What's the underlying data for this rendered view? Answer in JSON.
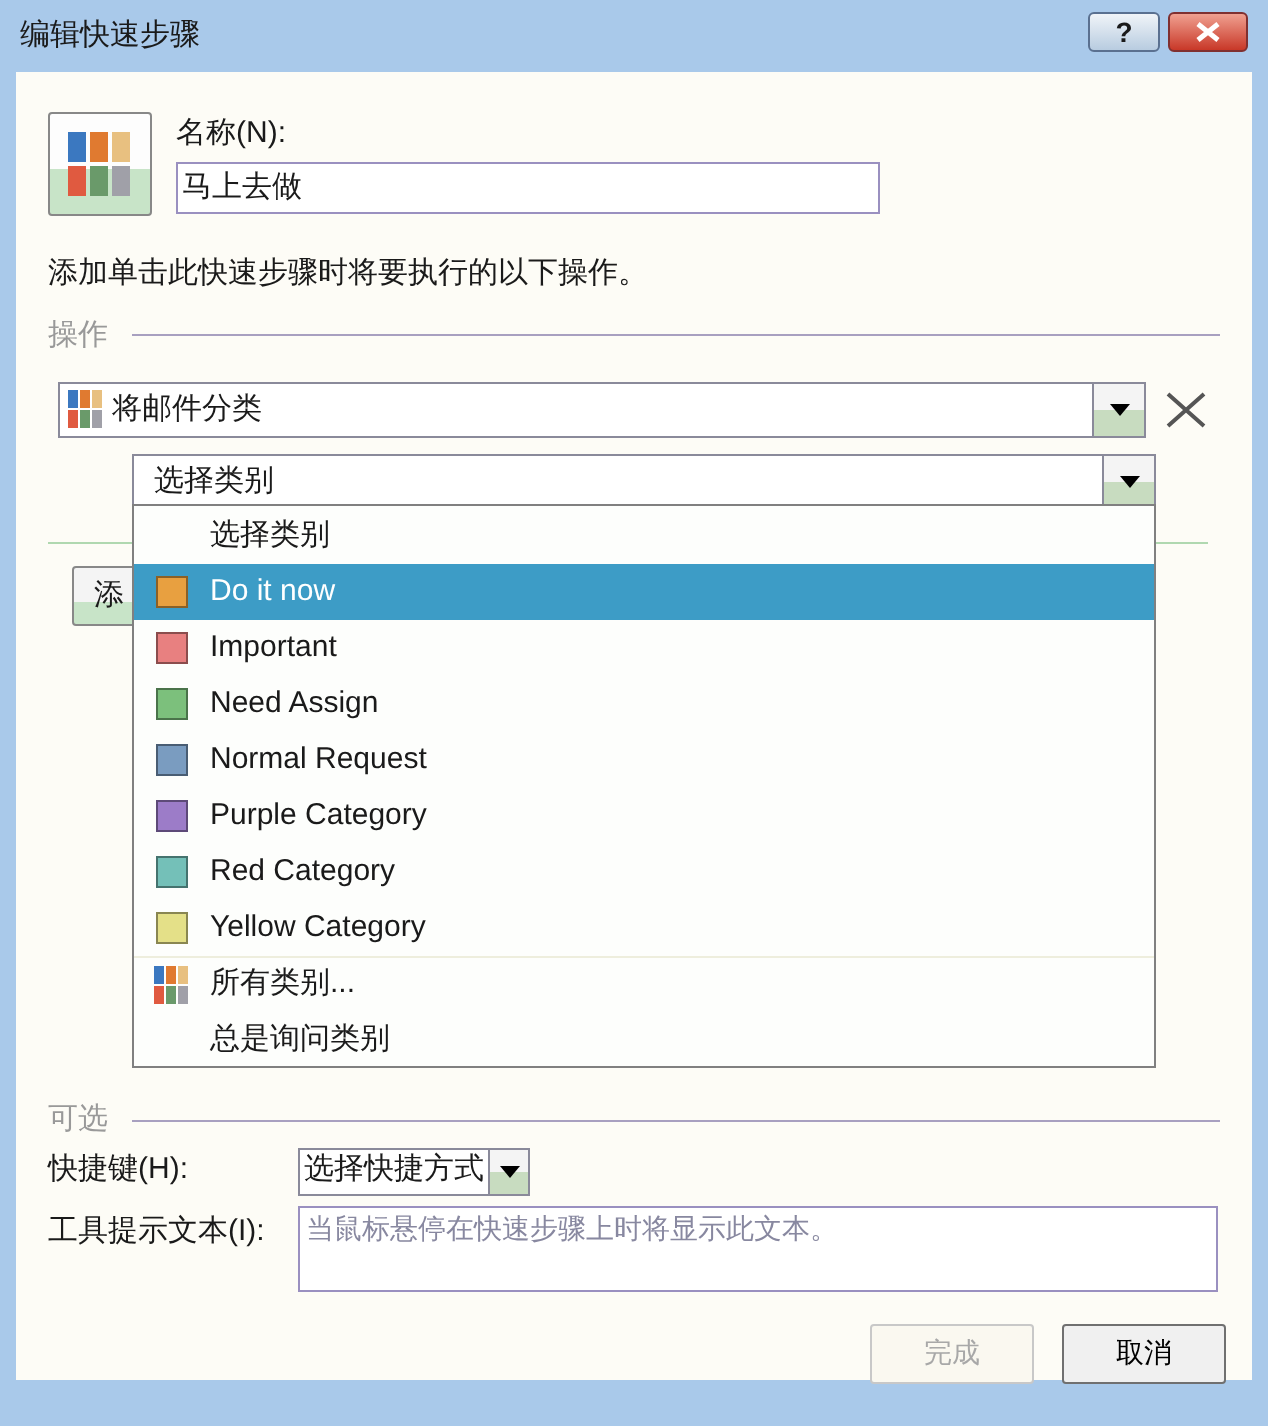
{
  "window": {
    "title": "编辑快速步骤",
    "help_button": "?"
  },
  "name": {
    "label": "名称(N):",
    "value": "马上去做"
  },
  "instruction": "添加单击此快速步骤时将要执行的以下操作。",
  "actions": {
    "heading": "操作",
    "action": "将邮件分类",
    "category_combo": "选择类别",
    "add_button": "添",
    "category_menu": [
      {
        "kind": "text",
        "label": "选择类别",
        "selected": false
      },
      {
        "kind": "category",
        "label": "Do it now",
        "color": "#e8a040",
        "selected": true
      },
      {
        "kind": "category",
        "label": "Important",
        "color": "#e88080",
        "selected": false
      },
      {
        "kind": "category",
        "label": "Need Assign",
        "color": "#7cc07c",
        "selected": false
      },
      {
        "kind": "category",
        "label": "Normal Request",
        "color": "#7a9cc0",
        "selected": false
      },
      {
        "kind": "category",
        "label": "Purple Category",
        "color": "#9c7cc8",
        "selected": false
      },
      {
        "kind": "category",
        "label": "Red Category",
        "color": "#74c0b8",
        "selected": false
      },
      {
        "kind": "category",
        "label": "Yellow Category",
        "color": "#e4e088",
        "selected": false
      },
      {
        "kind": "all",
        "label": "所有类别...",
        "selected": false
      },
      {
        "kind": "text",
        "label": "总是询问类别",
        "selected": false
      }
    ]
  },
  "optional": {
    "heading": "可选",
    "shortcut_label": "快捷键(H):",
    "shortcut_value": "选择快捷方式",
    "tooltip_label": "工具提示文本(I):",
    "tooltip_placeholder": "当鼠标悬停在快速步骤上时将显示此文本。"
  },
  "buttons": [
    {
      "label": "完成",
      "disabled": true
    },
    {
      "label": "取消",
      "disabled": false
    }
  ]
}
